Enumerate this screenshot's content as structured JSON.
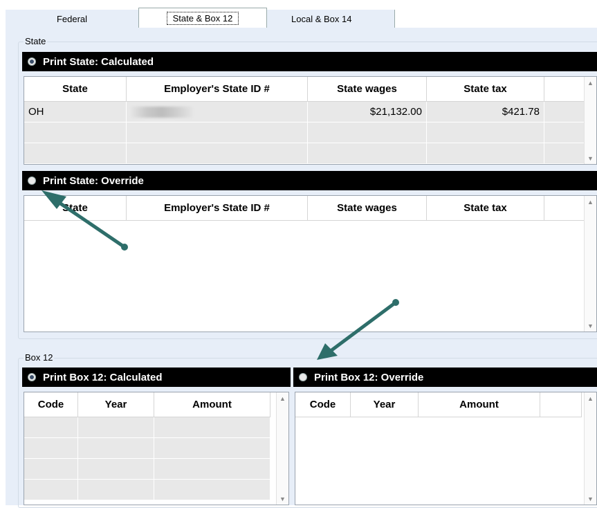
{
  "tabs": [
    "Federal",
    "State & Box 12",
    "Local & Box 14"
  ],
  "state_group": {
    "label": "State",
    "calculated_option": "Print State: Calculated",
    "override_option": "Print State: Override",
    "columns": [
      "State",
      "Employer's State ID #",
      "State wages",
      "State tax"
    ],
    "calculated_rows": [
      {
        "state": "OH",
        "employer_id": "",
        "wages": "$21,132.00",
        "tax": "$421.78"
      }
    ]
  },
  "box12_group": {
    "label": "Box 12",
    "calculated_option": "Print Box 12: Calculated",
    "override_option": "Print Box 12: Override",
    "columns": [
      "Code",
      "Year",
      "Amount"
    ]
  },
  "selected": {
    "state": "calculated",
    "box12": "calculated"
  },
  "icons": {
    "scroll_up": "▲",
    "scroll_down": "▼"
  },
  "colors": {
    "pane": "#e7eef8",
    "bar": "#000000",
    "arrow": "#2e6e6a"
  }
}
